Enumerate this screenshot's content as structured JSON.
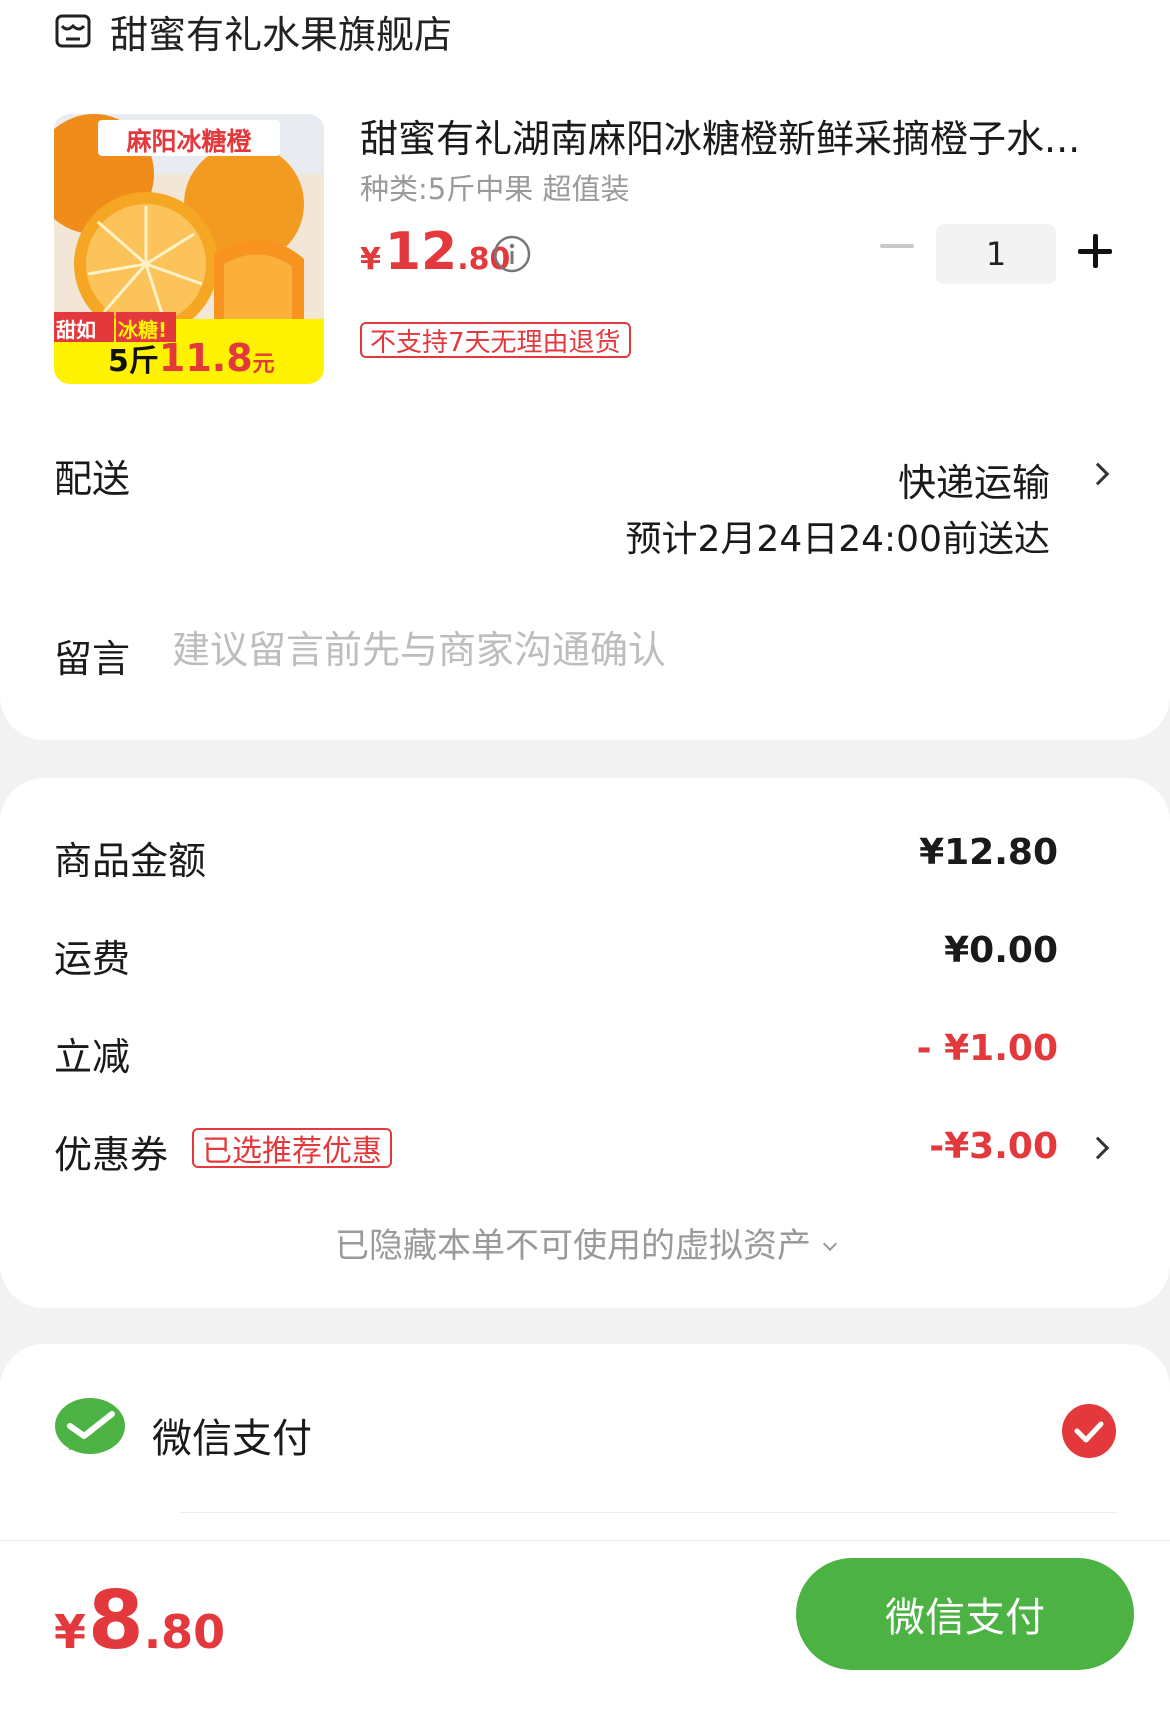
{
  "store": {
    "name": "甜蜜有礼水果旗舰店",
    "icon": "store-icon"
  },
  "product": {
    "title": "甜蜜有礼湖南麻阳冰糖橙新鲜采摘橙子水...",
    "spec": "种类:5斤中果 超值装",
    "price": {
      "yen": "¥",
      "int": "12",
      "dec": ".80"
    },
    "quantity": "1",
    "return_policy_tag": "不支持7天无理由退货",
    "image_text": {
      "banner": "麻阳冰糖橙",
      "badge_sweet": "甜如",
      "badge_sugar": "冰糖!",
      "weight": "5斤",
      "promo_price": "11.8",
      "unit": "元"
    }
  },
  "delivery": {
    "label": "配送",
    "method": "快递运输",
    "eta": "预计2月24日24:00前送达"
  },
  "message": {
    "label": "留言",
    "placeholder": "建议留言前先与商家沟通确认"
  },
  "fees": {
    "goods_label": "商品金额",
    "goods_value": "¥12.80",
    "shipping_label": "运费",
    "shipping_value": "¥0.00",
    "discount_label": "立减",
    "discount_value": "- ¥1.00",
    "coupon_label": "优惠券",
    "coupon_tag": "已选推荐优惠",
    "coupon_value": "-¥3.00",
    "hidden_assets": "已隐藏本单不可使用的虚拟资产"
  },
  "payment": {
    "method_label": "微信支付",
    "selected": true
  },
  "footer": {
    "total": {
      "yen": "¥",
      "int": "8",
      "dec": ".80"
    },
    "pay_button": "微信支付"
  },
  "colors": {
    "accent_red": "#e4393c",
    "wechat_green": "#4cb243"
  }
}
